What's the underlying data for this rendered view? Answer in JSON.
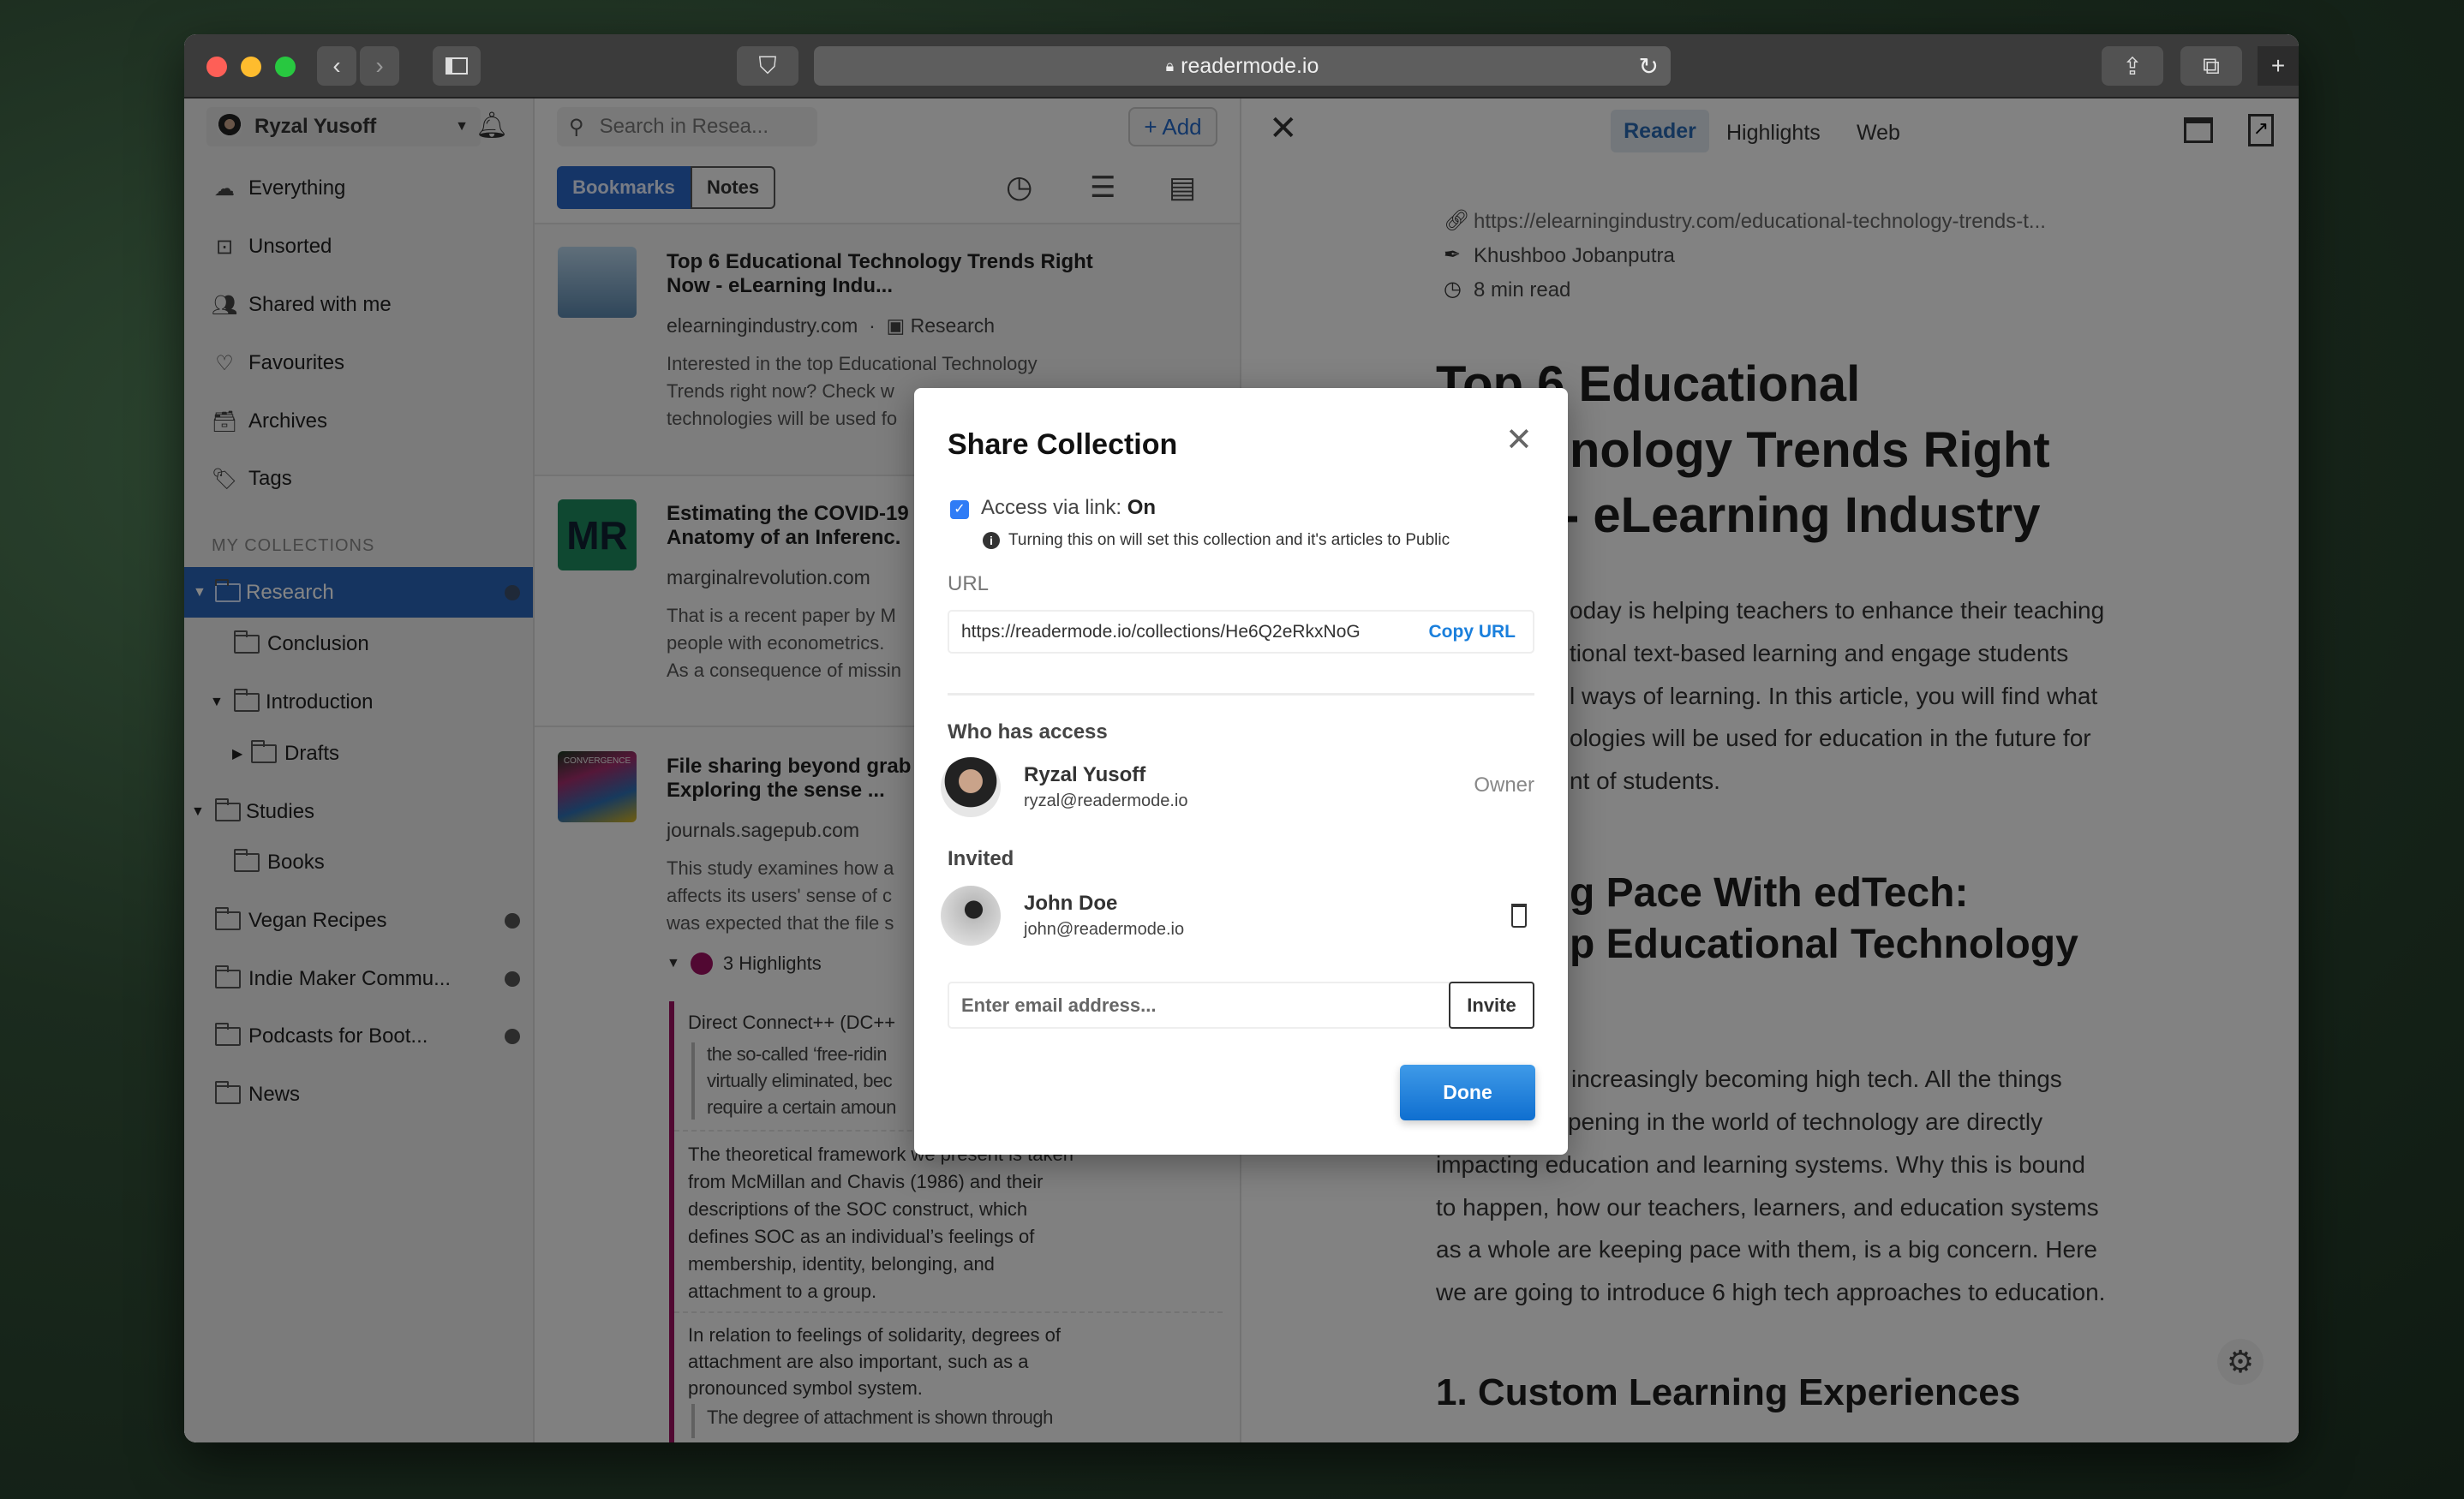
{
  "browser": {
    "url": "readermode.io"
  },
  "sidebar": {
    "user": "Ryzal Yusoff",
    "nav": [
      {
        "label": "Everything",
        "icon": "cloud-icon"
      },
      {
        "label": "Unsorted",
        "icon": "inbox-box-icon"
      },
      {
        "label": "Shared with me",
        "icon": "users-icon"
      },
      {
        "label": "Favourites",
        "icon": "heart-icon"
      },
      {
        "label": "Archives",
        "icon": "archive-icon"
      },
      {
        "label": "Tags",
        "icon": "tag-icon"
      }
    ],
    "section_title": "MY COLLECTIONS",
    "collections": [
      {
        "label": "Research",
        "selected": true,
        "shared": true
      },
      {
        "label": "Conclusion"
      },
      {
        "label": "Introduction"
      },
      {
        "label": "Drafts"
      },
      {
        "label": "Studies"
      },
      {
        "label": "Books"
      },
      {
        "label": "Vegan Recipes",
        "public": true
      },
      {
        "label": "Indie Maker Commu...",
        "public": true
      },
      {
        "label": "Podcasts for Boot...",
        "public": true
      },
      {
        "label": "News"
      }
    ]
  },
  "list": {
    "search_placeholder": "Search in Resea...",
    "add_label": "+ Add",
    "tabs": [
      "Bookmarks",
      "Notes"
    ],
    "active_tab": "Bookmarks",
    "items": [
      {
        "title": [
          "Top 6 Educational Technology Trends Right",
          "Now - eLearning Indu..."
        ],
        "domain": "elearningindustry.com",
        "collection": "Research",
        "desc": [
          "Interested in the top Educational Technology",
          "Trends right now? Check w",
          "technologies will be used fo"
        ]
      },
      {
        "title": [
          "Estimating the COVID-19",
          "Anatomy of an Inferenc."
        ],
        "domain": "marginalrevolution.com",
        "desc": [
          "That is a recent paper by M",
          "people with econometrics.",
          "As a consequence of missin"
        ],
        "thumb_text": "MR"
      },
      {
        "title": [
          "File sharing beyond grab",
          "Exploring the sense ..."
        ],
        "domain": "journals.sagepub.com",
        "desc": [
          "This study examines how a",
          "affects its users' sense of c",
          "was expected that the file s"
        ],
        "thumb_text": "CONVERGENCE",
        "highlights_label": "3 Highlights",
        "highlight_color": "#9c1060",
        "highlights": [
          {
            "text": [
              "Direct Connect++ (DC++"
            ],
            "quote": [
              "the so-called ‘free-ridin",
              "virtually eliminated, bec",
              "require a certain amoun"
            ]
          },
          {
            "text": [
              "The theoretical framework we present is taken",
              "from  McMillan and Chavis (1986)  and their",
              "descriptions of the SOC construct, which",
              "defines SOC as an individual’s feelings of",
              "membership, identity, belonging, and",
              "attachment to a group."
            ]
          },
          {
            "text": [
              "In relation to feelings of solidarity, degrees of",
              "attachment are also important, such as a",
              "pronounced symbol system."
            ],
            "quote": [
              "The degree of attachment is shown through"
            ]
          }
        ]
      }
    ]
  },
  "reader": {
    "tabs": [
      "Reader",
      "Highlights",
      "Web"
    ],
    "active_tab": "Reader",
    "url": "https://elearningindustry.com/educational-technology-trends-t...",
    "author": "Khushboo Jobanputra",
    "read_time": "8 min read",
    "title_lines": [
      "Top 6 Educational",
      "nology Trends Right",
      "- eLearning Industry"
    ],
    "para1": [
      "oday is helping teachers to enhance their teaching",
      "tional text-based learning and engage students",
      "l ways of learning. In this article, you will find what",
      "ologies will be used for education in the future for",
      "nt of students."
    ],
    "h2": [
      "g Pace With edTech:",
      "p Educational Technology"
    ],
    "para2_partial": [
      "increasingly becoming high tech. All the things",
      "pening in the world of technology are directly"
    ],
    "para2": [
      "impacting education and learning systems. Why this is bound",
      "to happen, how our teachers, learners, and education systems",
      "as a whole are keeping pace with them, is a big concern. Here",
      "we are going to introduce 6 high tech approaches to education."
    ],
    "h3": "1. Custom Learning Experiences"
  },
  "modal": {
    "title": "Share Collection",
    "access_label": "Access via link: ",
    "access_value": "On",
    "access_checked": true,
    "info": "Turning this on will set this collection and it's articles to Public",
    "url_label": "URL",
    "url": "https://readermode.io/collections/He6Q2eRkxNoG",
    "copy_label": "Copy URL",
    "who_title": "Who has access",
    "owner": {
      "name": "Ryzal Yusoff",
      "email": "ryzal@readermode.io",
      "role": "Owner"
    },
    "invited_title": "Invited",
    "invited": [
      {
        "name": "John Doe",
        "email": "john@readermode.io"
      }
    ],
    "email_placeholder": "Enter email address...",
    "invite_label": "Invite",
    "done_label": "Done",
    "accent": "#1a7fdc"
  }
}
